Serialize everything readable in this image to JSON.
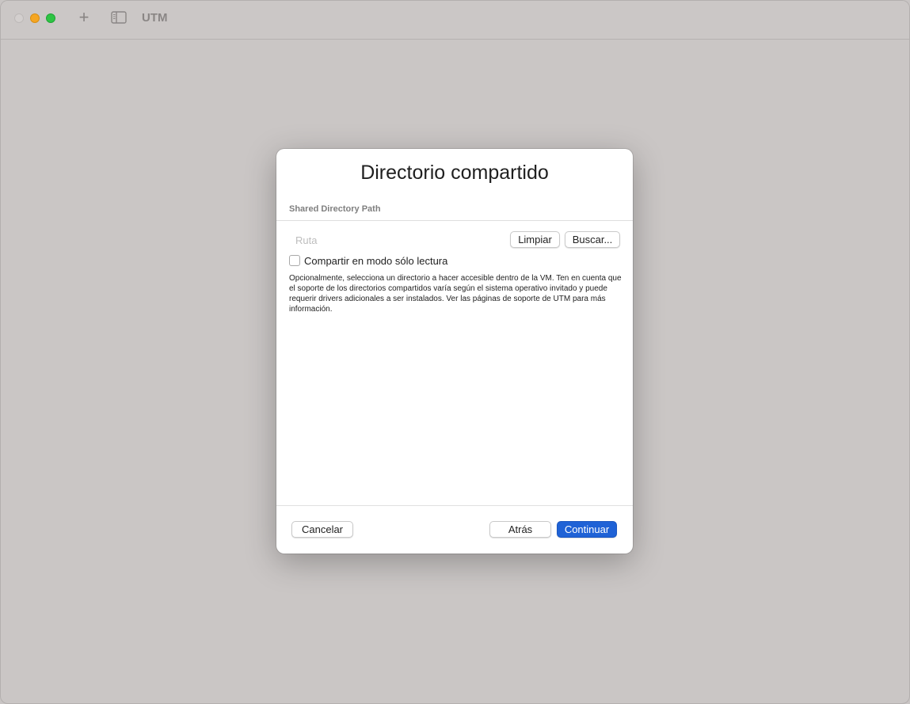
{
  "window": {
    "title": "UTM",
    "toolbar": {
      "add_icon": "plus-icon",
      "sidebar_icon": "sidebar-toggle-icon"
    }
  },
  "dialog": {
    "title": "Directorio compartido",
    "section_header": "Shared Directory Path",
    "path": {
      "placeholder": "Ruta",
      "value": ""
    },
    "clear_label": "Limpiar",
    "browse_label": "Buscar...",
    "readonly_checkbox": {
      "label": "Compartir en modo sólo lectura",
      "checked": false
    },
    "help_text": "Opcionalmente, selecciona un directorio a hacer accesible dentro de la VM. Ten en cuenta que el soporte de los directorios compartidos varía según el sistema operativo invitado y puede requerir drivers adicionales a ser instalados. Ver las páginas de soporte de UTM para más información.",
    "footer": {
      "cancel_label": "Cancelar",
      "back_label": "Atrás",
      "continue_label": "Continuar"
    }
  },
  "colors": {
    "accent": "#1f62d6",
    "window_bg": "#cac6c5",
    "dialog_bg": "#ffffff"
  }
}
